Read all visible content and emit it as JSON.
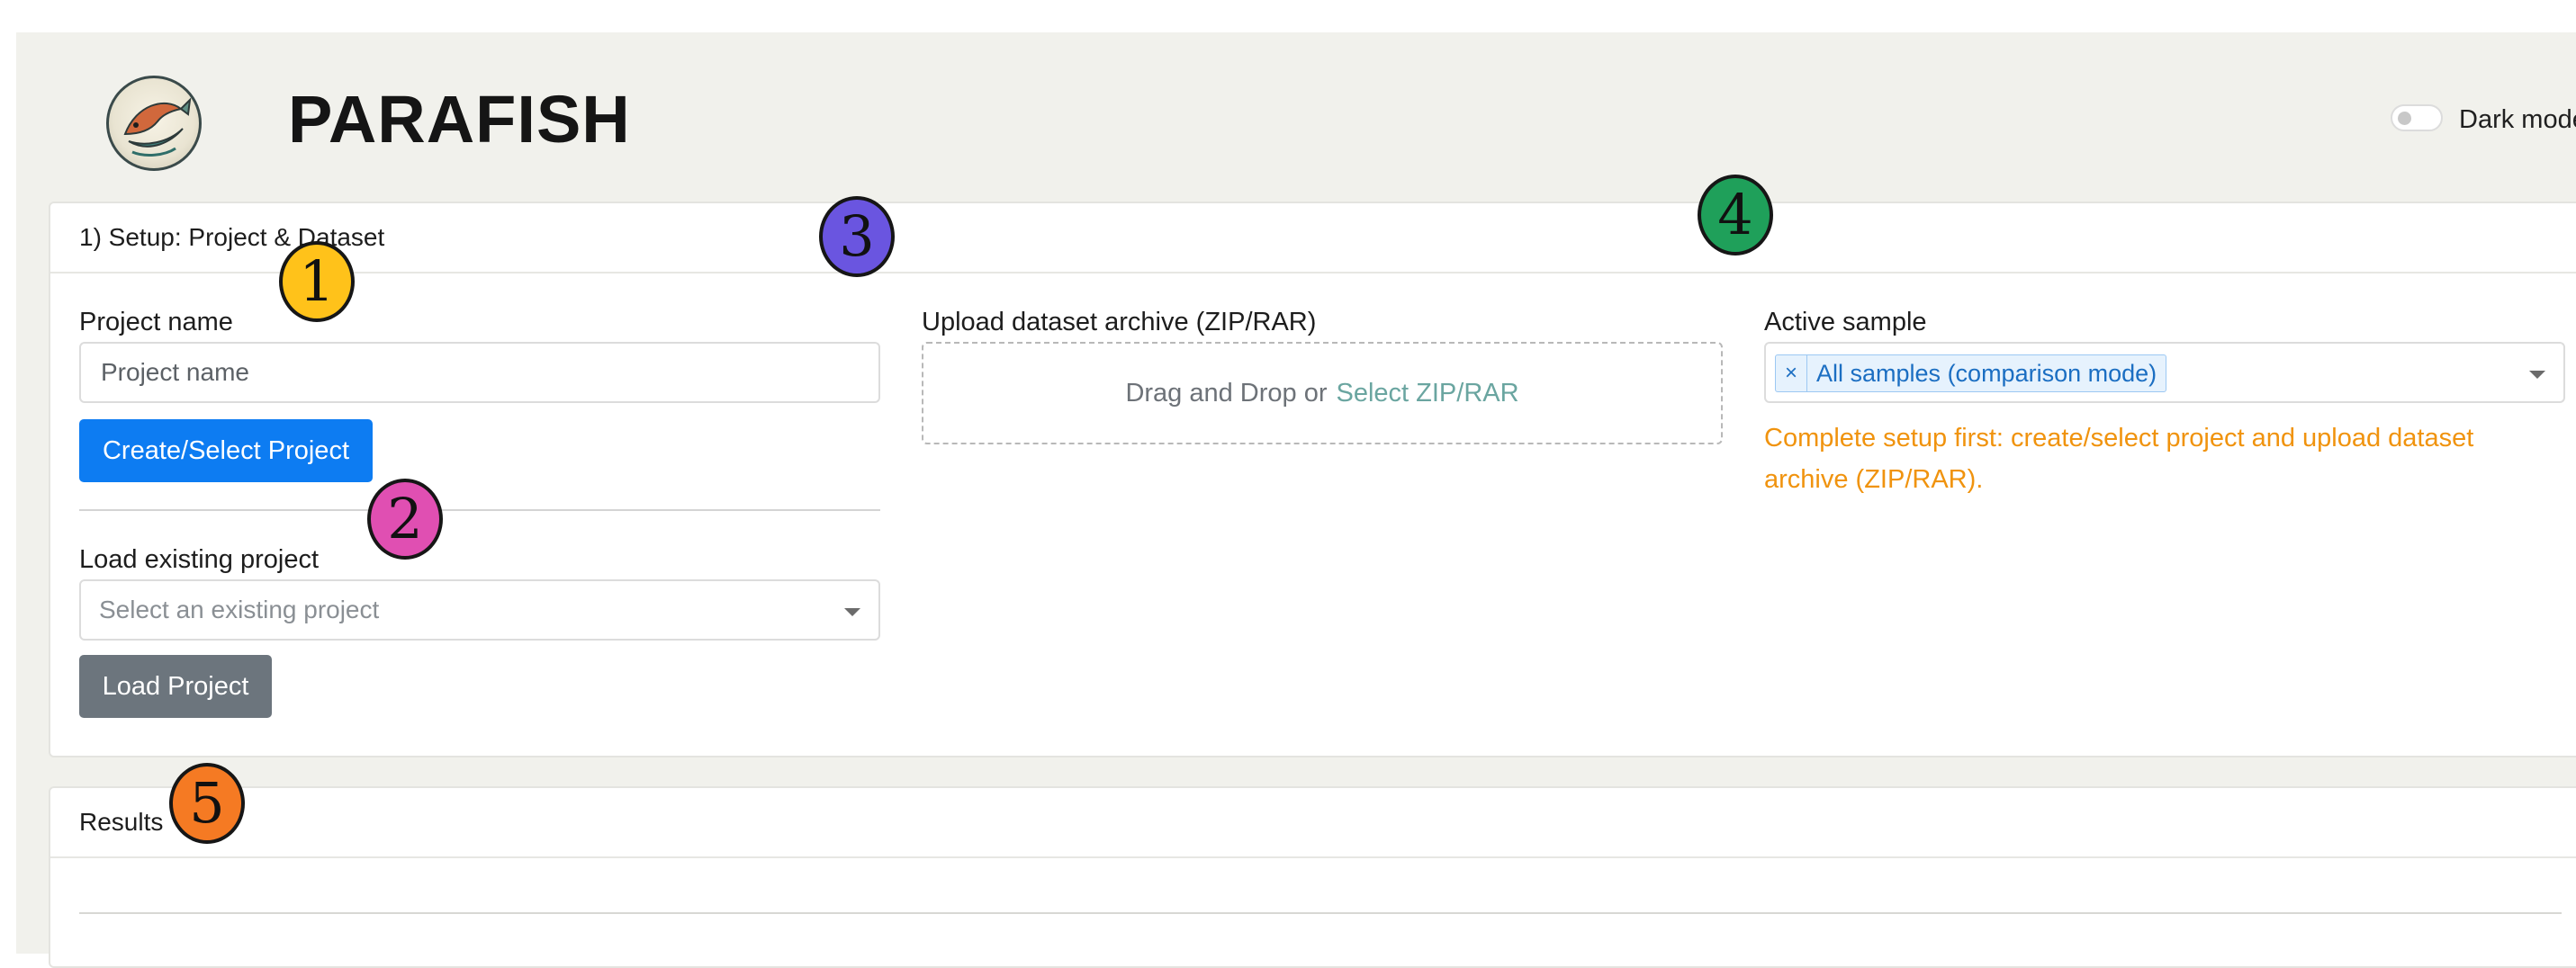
{
  "header": {
    "app_title": "PARAFISH",
    "logo_icon": "fish-logo-icon",
    "dark_mode_label": "Dark mode",
    "dark_mode_on": false
  },
  "setup": {
    "title": "1) Setup: Project & Dataset",
    "project_name_label": "Project name",
    "project_name_placeholder": "Project name",
    "project_name_value": "",
    "create_button": "Create/Select Project",
    "load_existing_label": "Load existing project",
    "load_existing_placeholder": "Select an existing project",
    "load_button": "Load Project",
    "upload_label": "Upload dataset archive (ZIP/RAR)",
    "upload_prompt": "Drag and Drop or",
    "upload_link": "Select ZIP/RAR",
    "active_sample_label": "Active sample",
    "active_sample_tag_remove": "×",
    "active_sample_selected": "All samples (comparison mode)",
    "warning": "Complete setup first: create/select project and upload dataset archive (ZIP/RAR)."
  },
  "results": {
    "title": "Results"
  },
  "callouts": [
    "1",
    "2",
    "3",
    "4",
    "5"
  ],
  "colors": {
    "primary": "#0d7cf2",
    "secondary": "#6c757d",
    "warning": "#f0930e",
    "link": "#6aa5a0",
    "tag": "#1b6ec2",
    "badge_1": "#ffc21a",
    "badge_2": "#e04fb2",
    "badge_3": "#6a55e0",
    "badge_4": "#1fa05a",
    "badge_5": "#f57a23"
  }
}
